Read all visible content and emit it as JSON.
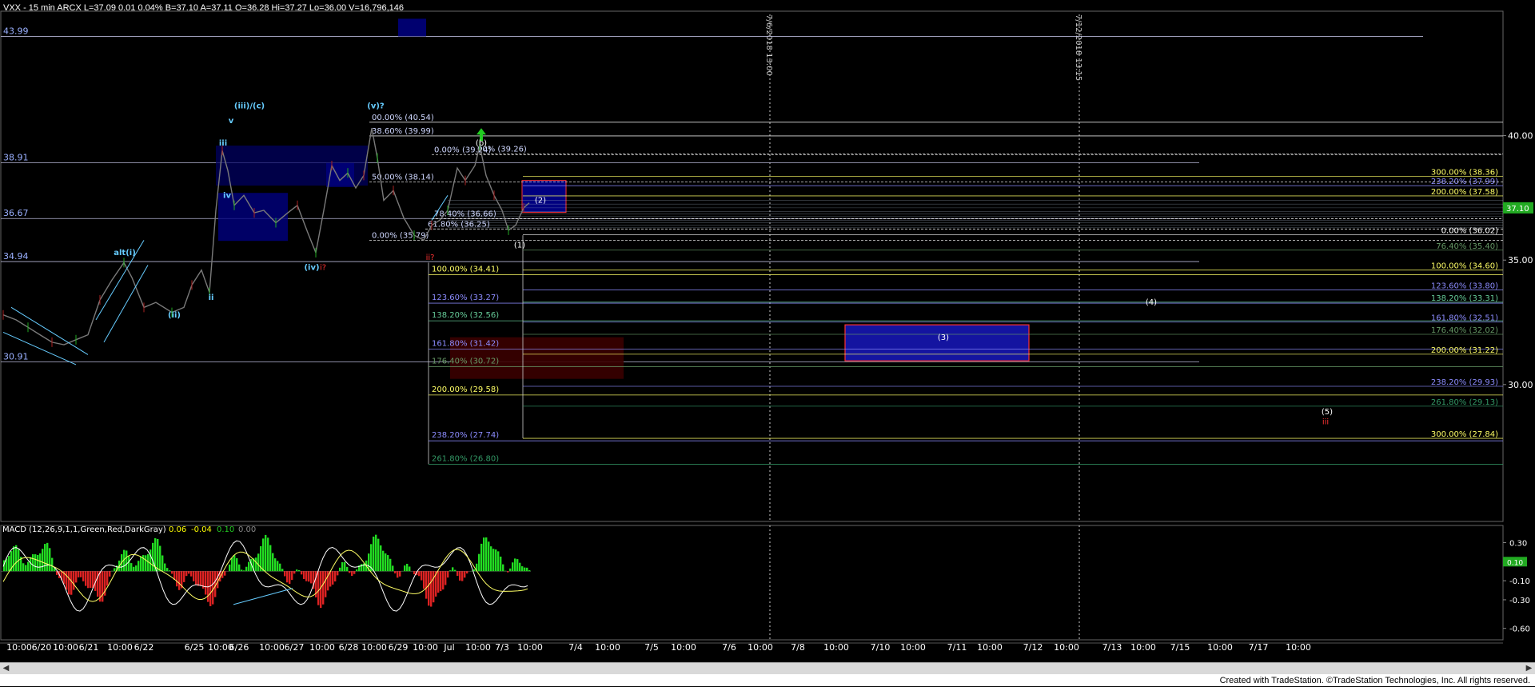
{
  "chart_data": {
    "type": "candlestick",
    "header": {
      "symbol": "VXX - 15 min",
      "exchange": "ARCX",
      "last": "L=37.09",
      "change": "0.01",
      "change_pct": "0.04%",
      "bid": "B=37.10",
      "ask": "A=37.11",
      "open": "O=36.28",
      "high": "Hi=37.27",
      "low": "Lo=36.00",
      "volume": "V=16,796,146"
    },
    "y_axis": {
      "ticks": [
        "40.00",
        "35.00",
        "30.00"
      ],
      "tick_values": [
        40,
        35,
        30
      ],
      "ylim": [
        24.5,
        45
      ],
      "current_price_label": "37.10"
    },
    "x_axis_labels": [
      "10:00",
      "6/20",
      "10:00",
      "6/21",
      "10:00",
      "6/22",
      "6/25",
      "10:00",
      "6/26",
      "10:00",
      "6/27",
      "10:00",
      "6/28",
      "10:00",
      "6/29",
      "10:00",
      "Jul",
      "10:00",
      "7/3",
      "10:00",
      "7/4",
      "10:00",
      "7/5",
      "10:00",
      "7/6",
      "10:00",
      "7/8",
      "10:00",
      "7/10",
      "10:00",
      "7/11",
      "10:00",
      "7/12",
      "10:00",
      "7/13",
      "10:00",
      "7/15",
      "10:00",
      "7/17",
      "10:00"
    ],
    "vertical_markers": [
      "7/6/2018 13:00",
      "7/12/2018 13:15"
    ],
    "left_levels": [
      {
        "label": "43.99",
        "value": 43.99
      },
      {
        "label": "38.91",
        "value": 38.91
      },
      {
        "label": "36.67",
        "value": 36.67
      },
      {
        "label": "34.94",
        "value": 34.94
      },
      {
        "label": "30.91",
        "value": 30.91
      }
    ],
    "fib_middle": [
      {
        "label": "100.00% (34.41)",
        "value": 34.41,
        "color": "#ffff66"
      },
      {
        "label": "123.60% (33.27)",
        "value": 33.27,
        "color": "#8c8cff"
      },
      {
        "label": "138.20% (32.56)",
        "value": 32.56,
        "color": "#66cc99"
      },
      {
        "label": "161.80% (31.42)",
        "value": 31.42,
        "color": "#8c8cff"
      },
      {
        "label": "176.40% (30.72)",
        "value": 30.72,
        "color": "#669966"
      },
      {
        "label": "200.00% (29.58)",
        "value": 29.58,
        "color": "#ffff66"
      },
      {
        "label": "238.20% (27.74)",
        "value": 27.74,
        "color": "#8c8cff"
      },
      {
        "label": "261.80% (26.80)",
        "value": 26.8,
        "color": "#339966"
      }
    ],
    "fib_right": [
      {
        "label": "300.00% (38.36)",
        "value": 38.36,
        "color": "#ffff66"
      },
      {
        "label": "238.20% (37.99)",
        "value": 37.99,
        "color": "#8c8cff"
      },
      {
        "label": "200.00% (37.58)",
        "value": 37.58,
        "color": "#ffff66"
      },
      {
        "label": "0.00% (36.02)",
        "value": 36.02,
        "color": "#ffffff"
      },
      {
        "label": "76.40% (35.40)",
        "value": 35.4,
        "color": "#669966"
      },
      {
        "label": "100.00% (34.60)",
        "value": 34.6,
        "color": "#ffff66"
      },
      {
        "label": "123.60% (33.80)",
        "value": 33.8,
        "color": "#8c8cff"
      },
      {
        "label": "138.20% (33.31)",
        "value": 33.31,
        "color": "#66cc99"
      },
      {
        "label": "161.80% (32.51)",
        "value": 32.51,
        "color": "#8c8cff"
      },
      {
        "label": "176.40% (32.02)",
        "value": 32.02,
        "color": "#669966"
      },
      {
        "label": "200.00% (31.22)",
        "value": 31.22,
        "color": "#ffff66"
      },
      {
        "label": "238.20% (29.93)",
        "value": 29.93,
        "color": "#8c8cff"
      },
      {
        "label": "261.80% (29.13)",
        "value": 29.13,
        "color": "#339966"
      },
      {
        "label": "300.00% (27.84)",
        "value": 27.84,
        "color": "#ffff66"
      }
    ],
    "fib_upper": [
      {
        "label": "00.00% (40.54)",
        "value": 40.54
      },
      {
        "label": "38.60% (39.99)",
        "value": 39.99
      },
      {
        "label": "0.00% (39.24)",
        "value": 39.24
      },
      {
        "label": "00% (39.26)",
        "value": 39.26
      },
      {
        "label": "50.00% (38.14)",
        "value": 38.14
      },
      {
        "label": "0.00% (35.79)",
        "value": 35.79
      },
      {
        "label": "78.40% (36.66)",
        "value": 36.66
      },
      {
        "label": "61.80% (36.25)",
        "value": 36.25
      }
    ],
    "wave_labels": [
      {
        "text": "(iii)/(c)",
        "color": "#66ccff",
        "date": "6/26 10:00",
        "price": 41.1
      },
      {
        "text": "v",
        "color": "#66ccff",
        "date": "6/26 10:00",
        "price": 40.5
      },
      {
        "text": "iii",
        "color": "#66ccff",
        "date": "6/25 10:00",
        "price": 39.6
      },
      {
        "text": "iv",
        "color": "#66ccff",
        "date": "6/25 12:00",
        "price": 37.5
      },
      {
        "text": "alt(i)",
        "color": "#66ccff",
        "date": "6/21 11:00",
        "price": 35.2
      },
      {
        "text": "(ii)",
        "color": "#66ccff",
        "date": "6/22 09:30",
        "price": 32.7
      },
      {
        "text": "ii",
        "color": "#66ccff",
        "date": "6/25 11:30",
        "price": 33.4
      },
      {
        "text": "(iv)",
        "color": "#66ccff",
        "date": "6/27 10:00",
        "price": 34.6
      },
      {
        "text": "i?",
        "color": "#ff3333",
        "date": "6/27 12:00",
        "price": 34.6
      },
      {
        "text": "(v)?",
        "color": "#66ccff",
        "date": "6/28 12:00",
        "price": 41.1
      },
      {
        "text": "(b)",
        "color": "#ffffff",
        "date": "Jul 12:00",
        "price": 39.6
      },
      {
        "text": "(2)",
        "color": "#ffffff",
        "date": "7/3 12:00",
        "price": 37.3
      },
      {
        "text": "(1)",
        "color": "#ffffff",
        "date": "7/3 09:45",
        "price": 35.5
      },
      {
        "text": "ii?",
        "color": "#ff3333",
        "date": "6/29 13:00",
        "price": 35.0
      },
      {
        "text": "(3)",
        "color": "#ffffff",
        "date": "7/10 10:00",
        "price": 31.8
      },
      {
        "text": "(4)",
        "color": "#ffffff",
        "date": "7/13 10:00",
        "price": 33.2
      },
      {
        "text": "(5)",
        "color": "#ffffff",
        "date": "7/15 12:00",
        "price": 28.8
      },
      {
        "text": "iii",
        "color": "#ff3333",
        "date": "7/15 12:00",
        "price": 28.4
      }
    ],
    "macd": {
      "title": "MACD (12,26,9,1,1,Green,Red,DarkGray)",
      "values": [
        "0.06",
        "-0.04",
        "0.10",
        "0.00"
      ],
      "ticks": [
        "0.30",
        "0.10",
        "-0.10",
        "-0.30",
        "-0.60"
      ],
      "tick_values": [
        0.3,
        0.1,
        -0.1,
        -0.3,
        -0.6
      ],
      "current_label": "0.10",
      "ylim": [
        -0.72,
        0.48
      ]
    }
  },
  "footer": {
    "credit": "Created with TradeStation. ©TradeStation Technologies, Inc. All rights reserved."
  }
}
